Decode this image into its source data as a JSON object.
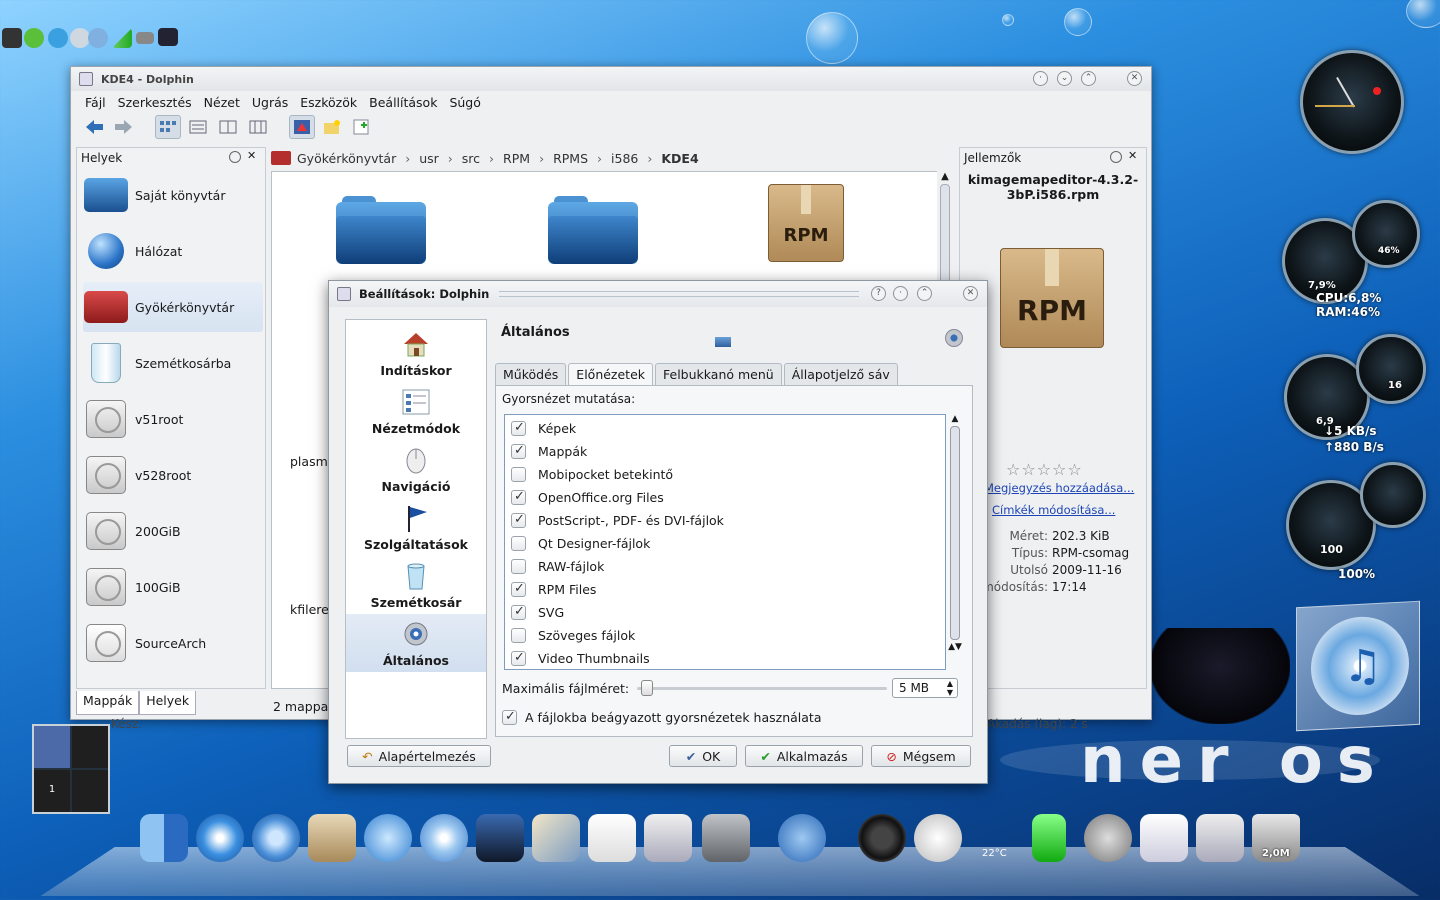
{
  "dolphin": {
    "title": "KDE4 - Dolphin",
    "menu": [
      "Fájl",
      "Szerkesztés",
      "Nézet",
      "Ugrás",
      "Eszközök",
      "Beállítások",
      "Súgó"
    ],
    "places_title": "Helyek",
    "places": [
      {
        "label": "Saját könyvtár",
        "icon": "home-folder-icon"
      },
      {
        "label": "Hálózat",
        "icon": "network-globe-icon"
      },
      {
        "label": "Gyökérkönyvtár",
        "icon": "red-folder-icon"
      },
      {
        "label": "Szemétkosárba",
        "icon": "trash-icon"
      },
      {
        "label": "v51root",
        "icon": "drive-icon"
      },
      {
        "label": "v528root",
        "icon": "drive-icon"
      },
      {
        "label": "200GiB",
        "icon": "drive-icon"
      },
      {
        "label": "100GiB",
        "icon": "drive-icon"
      },
      {
        "label": "SourceArch",
        "icon": "usb-drive-icon"
      }
    ],
    "bottom_tabs": [
      "Mappák",
      "Helyek"
    ],
    "breadcrumb": [
      "Gyökérkönyvtár",
      "usr",
      "src",
      "RPM",
      "RPMS",
      "i586",
      "KDE4"
    ],
    "content_partial": [
      "plasm",
      "kfilere"
    ],
    "status": "2 mappa",
    "status_ready": "Kész.",
    "status_right": "Akadás (lag): 2 s",
    "info_panel": {
      "title": "Jellemzők",
      "filename": "kimagemapeditor-4.3.2-3bP.i586.rpm",
      "add_comment": "Megjegyzés hozzáadása...",
      "edit_tags": "Címkék módosítása...",
      "fields": [
        {
          "k": "Méret:",
          "v": "202.3 KiB"
        },
        {
          "k": "Típus:",
          "v": "RPM-csomag"
        },
        {
          "k": "Utolsó",
          "v": "2009-11-16"
        },
        {
          "k": "módosítás:",
          "v": "17:14"
        }
      ]
    },
    "rpm_label": "RPM"
  },
  "dialog": {
    "title": "Beállítások: Dolphin",
    "categories": [
      {
        "label": "Indításkor",
        "icon": "house-icon"
      },
      {
        "label": "Nézetmódok",
        "icon": "view-modes-icon"
      },
      {
        "label": "Navigáció",
        "icon": "mouse-icon"
      },
      {
        "label": "Szolgáltatások",
        "icon": "flag-icon"
      },
      {
        "label": "Szemétkosár",
        "icon": "trash-icon"
      },
      {
        "label": "Általános",
        "icon": "gear-icon"
      }
    ],
    "page_title": "Általános",
    "tabs": [
      "Működés",
      "Előnézetek",
      "Felbukkanó menü",
      "Állapotjelző sáv"
    ],
    "active_tab": 1,
    "preview_label": "Gyorsnézet mutatása:",
    "items": [
      {
        "label": "Képek",
        "checked": true
      },
      {
        "label": "Mappák",
        "checked": true
      },
      {
        "label": "Mobipocket betekintő",
        "checked": false
      },
      {
        "label": "OpenOffice.org Files",
        "checked": true
      },
      {
        "label": "PostScript-, PDF- és DVI-fájlok",
        "checked": true
      },
      {
        "label": "Qt Designer-fájlok",
        "checked": false
      },
      {
        "label": "RAW-fájlok",
        "checked": false
      },
      {
        "label": "RPM Files",
        "checked": true
      },
      {
        "label": "SVG",
        "checked": true
      },
      {
        "label": "Szöveges fájlok",
        "checked": false
      },
      {
        "label": "Video Thumbnails",
        "checked": true
      }
    ],
    "max_size_label": "Maximális fájlméret:",
    "max_size_value": "5 MB",
    "embedded_label": "A fájlokba beágyazott gyorsnézetek használata",
    "embedded_checked": true,
    "buttons": {
      "defaults": "Alapértelmezés",
      "ok": "OK",
      "apply": "Alkalmazás",
      "cancel": "Mégsem"
    }
  },
  "widgets": {
    "cpu": "CPU:6,8%",
    "ram": "RAM:46%",
    "g1_small": "46%",
    "g1_big": "7,9%",
    "net_down": "↓5 KB/s",
    "net_up": "↑880 B/s",
    "g2_small": "16",
    "g2_big": "6,9",
    "g3_big": "100",
    "battery": "100%"
  },
  "dock": {
    "temp": "22°C",
    "trash_size": "2,0M"
  },
  "pager": {
    "desktop": "1"
  },
  "brand_text": "ner os"
}
